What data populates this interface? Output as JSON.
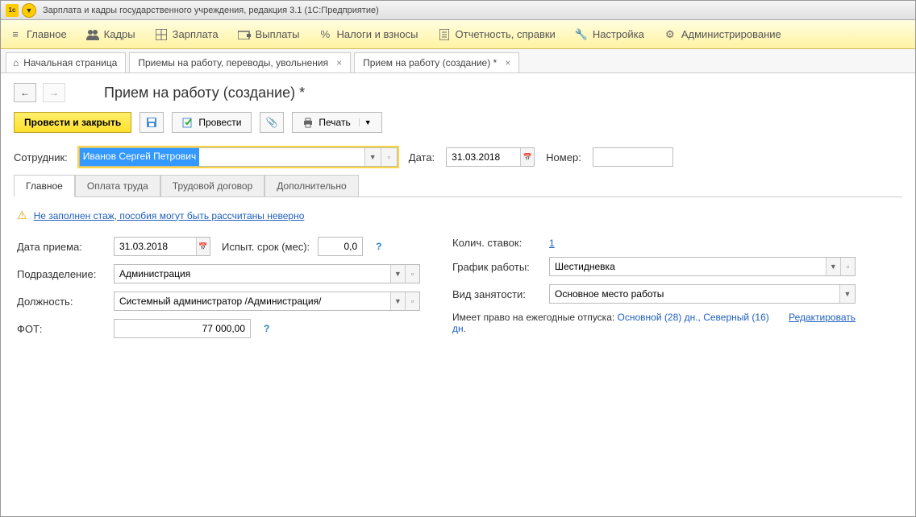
{
  "titlebar": {
    "text": "Зарплата и кадры государственного учреждения, редакция 3.1  (1С:Предприятие)",
    "logo": "1с"
  },
  "menu": [
    {
      "icon": "menu",
      "label": "Главное"
    },
    {
      "icon": "people",
      "label": "Кадры"
    },
    {
      "icon": "table",
      "label": "Зарплата"
    },
    {
      "icon": "wallet",
      "label": "Выплаты"
    },
    {
      "icon": "percent",
      "label": "Налоги и взносы"
    },
    {
      "icon": "report",
      "label": "Отчетность, справки"
    },
    {
      "icon": "wrench",
      "label": "Настройка"
    },
    {
      "icon": "gear",
      "label": "Администрирование"
    }
  ],
  "tabs": {
    "home": "Начальная страница",
    "t1": "Приемы на работу, переводы, увольнения",
    "t2": "Прием на работу (создание) *"
  },
  "page": {
    "title": "Прием на работу (создание) *",
    "btn_primary": "Провести и закрыть",
    "btn_provesti": "Провести",
    "btn_print": "Печать",
    "employee_label": "Сотрудник:",
    "employee_value": "Иванов Сергей Петрович",
    "date_label": "Дата:",
    "date_value": "31.03.2018",
    "number_label": "Номер:",
    "number_value": ""
  },
  "innerTabs": [
    "Главное",
    "Оплата труда",
    "Трудовой договор",
    "Дополнительно"
  ],
  "warning": "Не заполнен стаж, пособия могут быть рассчитаны неверно",
  "form": {
    "hire_date_label": "Дата приема:",
    "hire_date": "31.03.2018",
    "trial_label": "Испыт. срок (мес):",
    "trial": "0,0",
    "dept_label": "Подразделение:",
    "dept": "Администрация",
    "pos_label": "Должность:",
    "pos": "Системный администратор /Администрация/",
    "fot_label": "ФОТ:",
    "fot": "77 000,00",
    "rate_label": "Колич. ставок:",
    "rate": "1",
    "schedule_label": "График работы:",
    "schedule": "Шестидневка",
    "emptype_label": "Вид занятости:",
    "emptype": "Основное место работы",
    "vacation_prefix": "Имеет право на ежегодные отпуска: ",
    "vacation_main": "Основной (28) дн., Северный (16) дн.",
    "vacation_edit": "Редактировать"
  }
}
